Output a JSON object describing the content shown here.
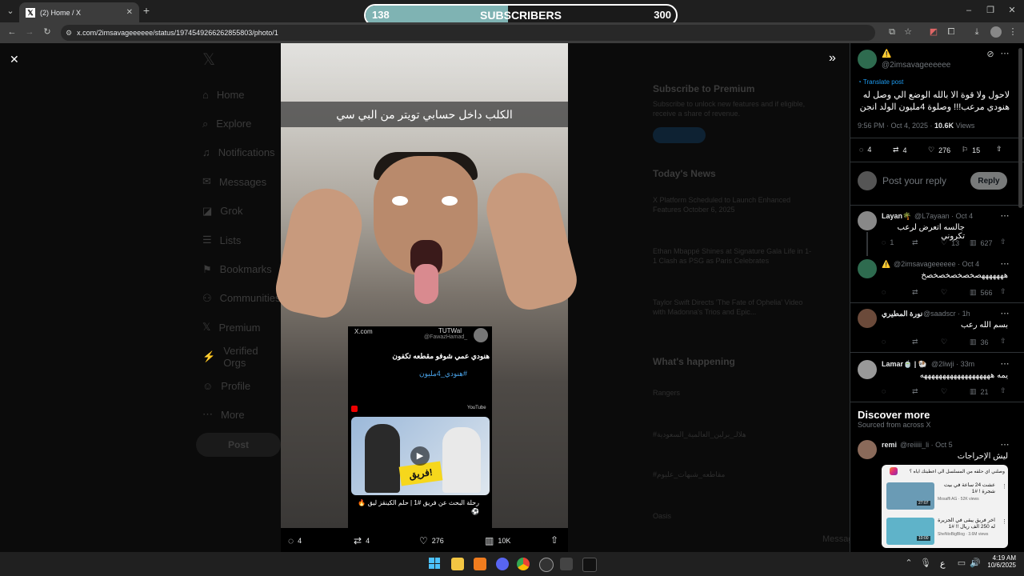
{
  "browser": {
    "tab_title": "(2) Home / X",
    "url": "x.com/2imsavageeeeee/status/1974549266262855803/photo/1"
  },
  "overlay": {
    "left_value": "138",
    "label": "SUBSCRIBERS",
    "right_value": "300",
    "progress": 0.46
  },
  "background_page": {
    "nav": [
      "Home",
      "Explore",
      "Notifications",
      "Messages",
      "Grok",
      "Lists",
      "Bookmarks",
      "Communities",
      "Premium",
      "Verified Orgs",
      "Profile",
      "More"
    ],
    "post_button": "Post",
    "premium_title": "Subscribe to Premium",
    "premium_text": "Subscribe to unlock new features and if eligible, receive a share of revenue.",
    "news_title": "Today's News",
    "news_items": [
      "X Platform Scheduled to Launch Enhanced Features October 6, 2025",
      "Ethan Mbappé Shines at Signature Gala Life in 1-1 Clash as PSG as Paris Celebrates",
      "Taylor Swift Directs 'The Fate of Ophelia' Video with Madonna's Trios and Epic..."
    ],
    "happening_title": "What's happening",
    "happening_items": [
      "Rangers",
      "#هلالـ_برلين_العالمية_السعودية",
      "#مقاطعه_شبهات_عليوم",
      "Oasis"
    ],
    "messages_label": "Messages"
  },
  "photo": {
    "caption": "الكلب داخل حسابي تويتر من البي سي",
    "inner_post": {
      "source": "X.com",
      "user": "TUTWal",
      "handle": "@FawazHamad_",
      "text": "هنودي عمي شوفو مقطعه تكفون",
      "hashtag": "#هنودي_4مليون",
      "youtube_label": "YouTube",
      "thumb_text": "فريق!",
      "video_title": "رحلة البحث عن فريق #1 | حلم الكينقز ليق 🔥⚽"
    }
  },
  "photo_actions": {
    "replies": "4",
    "reposts": "4",
    "likes": "276",
    "views": "10K"
  },
  "right_panel": {
    "author": {
      "name_icon": "⚠️",
      "handle": "@2imsavageeeeee"
    },
    "translate_label": "Translate post",
    "post_text": "لاحول ولا قوة الا بالله الوضع الي وصل له هنودي مرعب!!! وصلوة 4مليون الولد انجن",
    "timestamp": "9:56 PM · Oct 4, 2025 · ",
    "views_count": "10.6K",
    "views_label": " Views",
    "stats": {
      "replies": "4",
      "reposts": "4",
      "likes": "276",
      "bookmarks": "15"
    },
    "reply_placeholder": "Post your reply",
    "reply_button": "Reply",
    "replies": [
      {
        "name": "Layan🌴",
        "handle": "@L7ayaan · Oct 4",
        "text": "جالسه اتعرض لرعب تكروني",
        "replies": "1",
        "reposts": "",
        "likes": "13",
        "views": "627"
      },
      {
        "name": "⚠️",
        "handle": "@2imsavageeeeee · Oct 4",
        "text": "هههههههصخصخصخصخصخ",
        "replies": "",
        "reposts": "",
        "likes": "",
        "views": "566"
      },
      {
        "name": "نورة المطيري",
        "handle": "@saadscr · 1h",
        "text": "بسم الله رعب",
        "replies": "",
        "reposts": "",
        "likes": "",
        "views": "36"
      },
      {
        "name": "Lamar🍵 | 🐏",
        "handle": "@2liwji · 33m",
        "text": "يمه هههههههههههههههههههه",
        "replies": "",
        "reposts": "",
        "likes": "",
        "views": "21"
      }
    ],
    "discover_title": "Discover more",
    "discover_sub": "Sourced from across X",
    "discover_post": {
      "name": "remi",
      "handle": "@reiiiii_li · Oct 5",
      "text": "ليش الإحراجات",
      "card_header": "وصلني اي حلقه من المسلسل الي اعطيتك اياه ؟",
      "videos": [
        {
          "title": "عشت 24 ساعة في بيت شجرة ! #1",
          "meta": "Mosaffi AG · 52K views",
          "time": "27:07"
        },
        {
          "title": "اخر فريق يبقى في الجزيرة له 250 الف ريال !! #1",
          "meta": "SheNtoBigBlog · 3.6M views",
          "time": "10:00"
        }
      ]
    }
  },
  "taskbar": {
    "time": "4:19 AM",
    "date": "10/6/2025",
    "lang": "ع"
  }
}
